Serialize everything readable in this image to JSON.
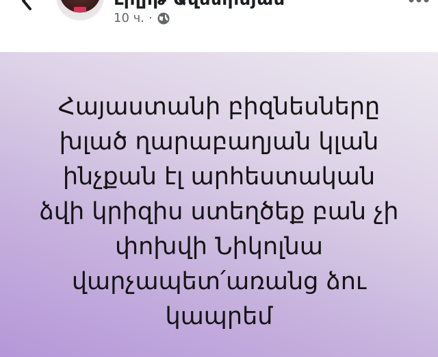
{
  "header": {
    "author_name": "Լիլիթ Ավետիսյան",
    "timestamp": "10 ч.",
    "separator": "·",
    "privacy_icon": "globe-icon",
    "back_icon": "chevron-left-icon",
    "more_icon": "more-dots-icon"
  },
  "post": {
    "text": "Հայաստանի բիզնեսները\nխլած ղարաբաղյան կլան\nինչքան էլ արհեստական\nձվի կրիզիս  ստեղծեք բան չի\nփոխվի Նիկոլնա\nվարչապետ՛առանց ձու\nկապրեմ",
    "background_top": "#ede9f0",
    "background_bottom": "#b597d9"
  }
}
